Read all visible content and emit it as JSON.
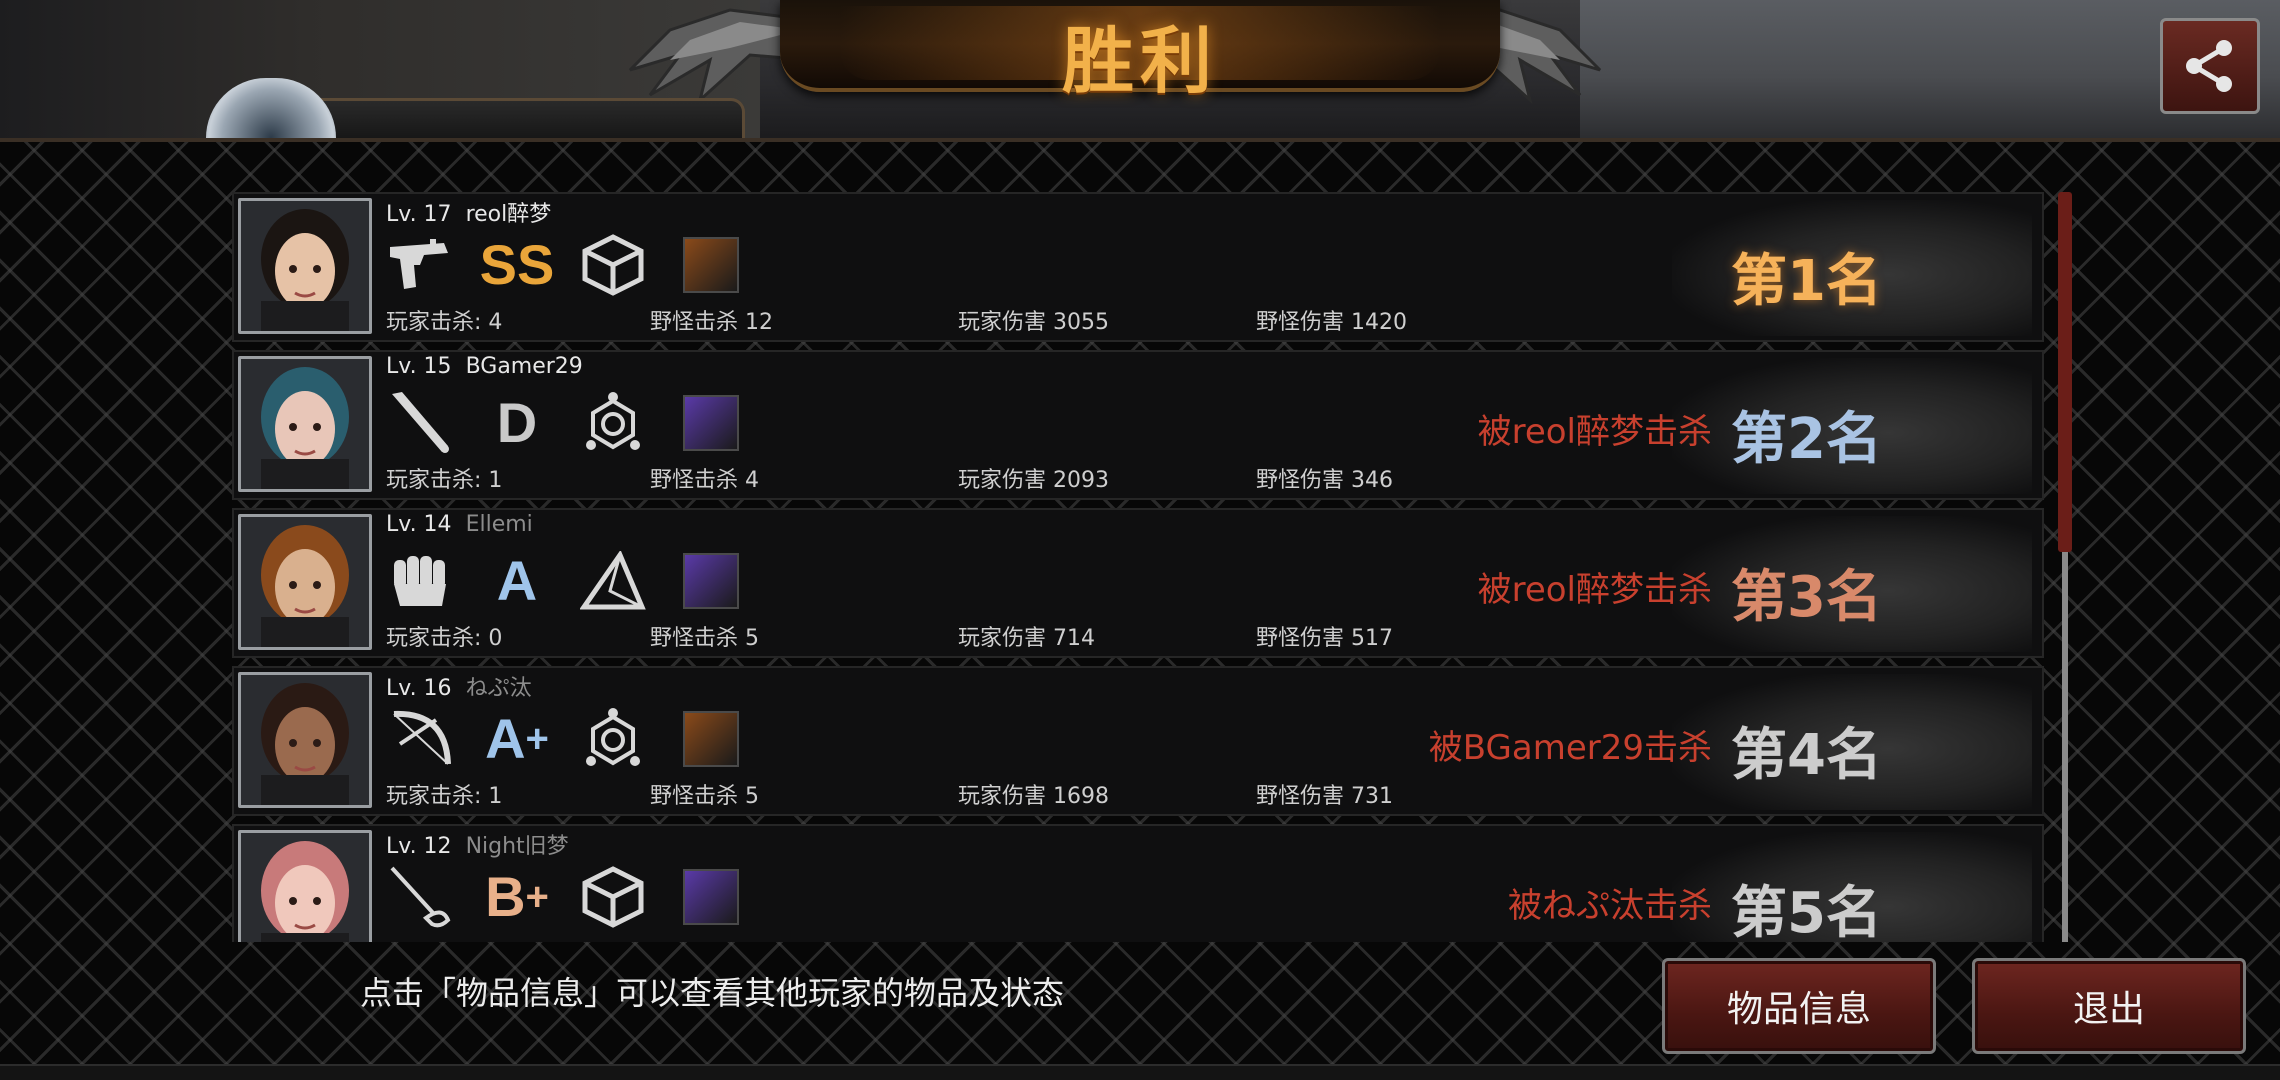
{
  "title": "胜利",
  "share_icon": "share-icon",
  "players": [
    {
      "level": "Lv. 17",
      "name": "reol醉梦",
      "name_dim": false,
      "weapon_icon": "pistol-icon",
      "grade": "SS",
      "grade_color": "#e9a53a",
      "skill_icon": "cube-icon",
      "item_color": "#8a4a1a",
      "player_kills": "玩家击杀: 4",
      "monster_kills": "野怪击杀 12",
      "player_damage": "玩家伤害 3055",
      "monster_damage": "野怪伤害 1420",
      "killed_by": "",
      "rank": "第1名",
      "skin": "#e6c2a6",
      "hair": "#1b1512"
    },
    {
      "level": "Lv. 15",
      "name": "BGamer29",
      "name_dim": false,
      "weapon_icon": "baseball-bat-icon",
      "grade": "D",
      "grade_color": "#c9c9c9",
      "skill_icon": "hexagon-node-icon",
      "item_color": "#5a3aa8",
      "player_kills": "玩家击杀: 1",
      "monster_kills": "野怪击杀 4",
      "player_damage": "玩家伤害 2093",
      "monster_damage": "野怪伤害 346",
      "killed_by": "被reol醉梦击杀",
      "rank": "第2名",
      "skin": "#e8c6b8",
      "hair": "#2a5e6e"
    },
    {
      "level": "Lv. 14",
      "name": "Ellemi",
      "name_dim": true,
      "weapon_icon": "fist-icon",
      "grade": "A",
      "grade_color": "#9fc4ea",
      "skill_icon": "triangle-icon",
      "item_color": "#5a3aa8",
      "player_kills": "玩家击杀: 0",
      "monster_kills": "野怪击杀 5",
      "player_damage": "玩家伤害 714",
      "monster_damage": "野怪伤害 517",
      "killed_by": "被reol醉梦击杀",
      "rank": "第3名",
      "skin": "#d9b08e",
      "hair": "#8a4a1c"
    },
    {
      "level": "Lv. 16",
      "name": "ねぷ汰",
      "name_dim": true,
      "weapon_icon": "bow-icon",
      "grade": "A+",
      "grade_color": "#9fc4ea",
      "skill_icon": "hexagon-node-icon",
      "item_color": "#8a4a1a",
      "player_kills": "玩家击杀: 1",
      "monster_kills": "野怪击杀 5",
      "player_damage": "玩家伤害 1698",
      "monster_damage": "野怪伤害 731",
      "killed_by": "被BGamer29击杀",
      "rank": "第4名",
      "skin": "#9a6a4e",
      "hair": "#2a1a14"
    },
    {
      "level": "Lv. 12",
      "name": "Night旧梦",
      "name_dim": true,
      "weapon_icon": "rapier-icon",
      "grade": "B+",
      "grade_color": "#e8b08a",
      "skill_icon": "cube-icon",
      "item_color": "#5a3aa8",
      "player_kills": "",
      "monster_kills": "",
      "player_damage": "",
      "monster_damage": "",
      "killed_by": "被ねぷ汰击杀",
      "rank": "第5名",
      "skin": "#f0c8bc",
      "hair": "#c87a7a"
    }
  ],
  "hint": "点击「物品信息」可以查看其他玩家的物品及状态",
  "buttons": {
    "items": "物品信息",
    "quit": "退出"
  }
}
